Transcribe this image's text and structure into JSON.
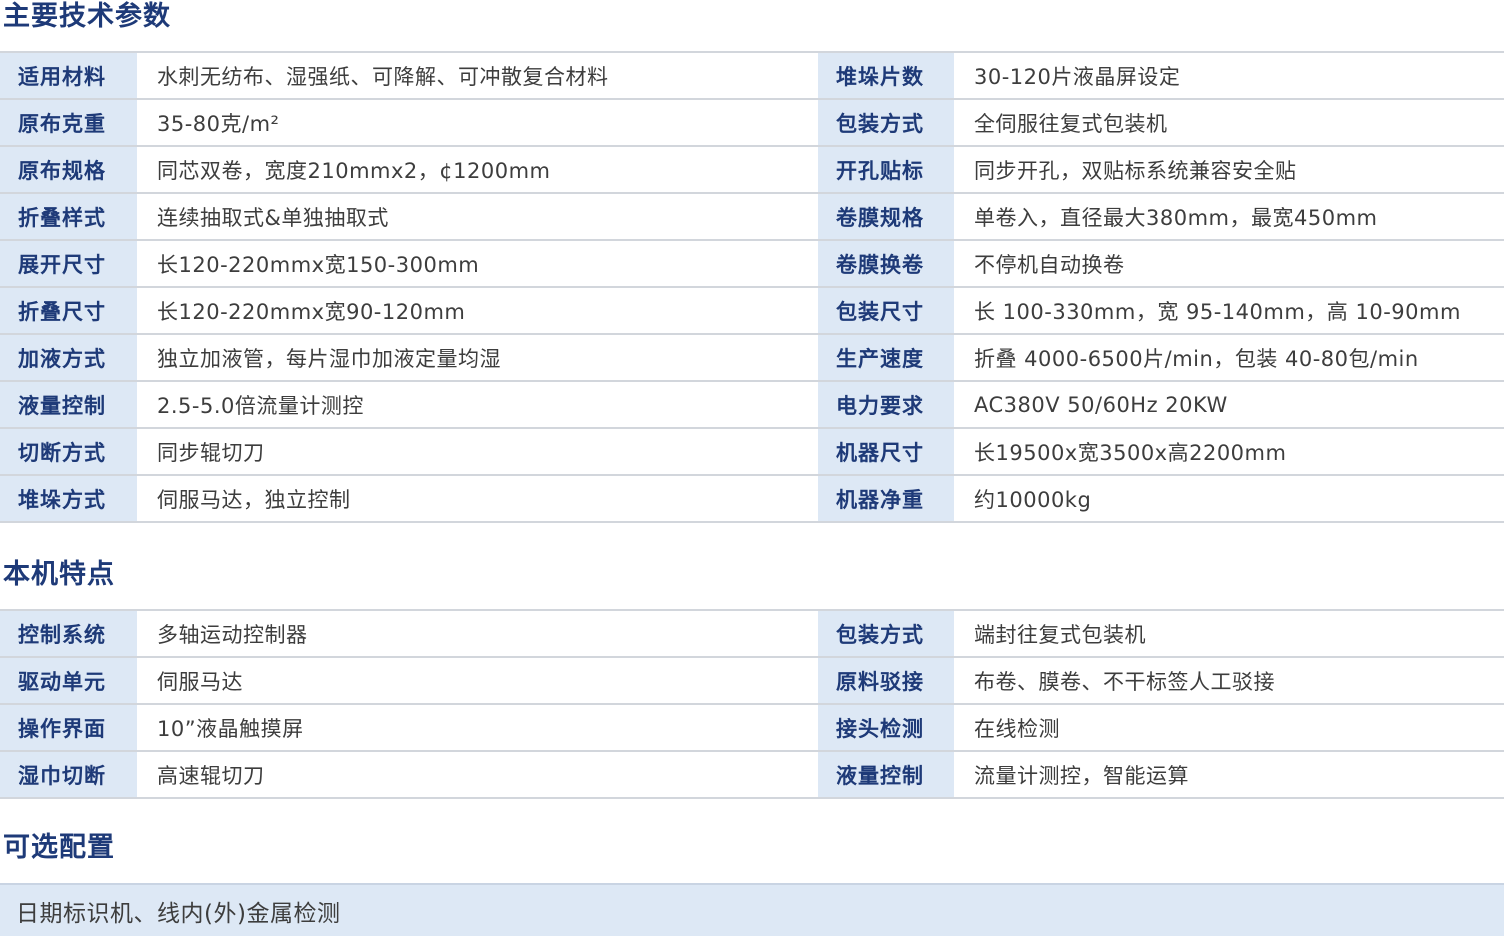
{
  "sections": {
    "main_specs": {
      "title": "主要技术参数",
      "rows": [
        {
          "left_label": "适用材料",
          "left_value": "水刺无纺布、湿强纸、可降解、可冲散复合材料",
          "right_label": "堆垛片数",
          "right_value": "30-120片液晶屏设定"
        },
        {
          "left_label": "原布克重",
          "left_value": "35-80克/m²",
          "right_label": "包装方式",
          "right_value": "全伺服往复式包装机"
        },
        {
          "left_label": "原布规格",
          "left_value": "同芯双卷，宽度210mmx2，¢1200mm",
          "right_label": "开孔贴标",
          "right_value": "同步开孔，双贴标系统兼容安全贴"
        },
        {
          "left_label": "折叠样式",
          "left_value": "连续抽取式&单独抽取式",
          "right_label": "卷膜规格",
          "right_value": "单卷入，直径最大380mm，最宽450mm"
        },
        {
          "left_label": "展开尺寸",
          "left_value": "长120-220mmx宽150-300mm",
          "right_label": "卷膜换卷",
          "right_value": "不停机自动换卷"
        },
        {
          "left_label": "折叠尺寸",
          "left_value": "长120-220mmx宽90-120mm",
          "right_label": "包装尺寸",
          "right_value": "长 100-330mm，宽 95-140mm，高 10-90mm"
        },
        {
          "left_label": "加液方式",
          "left_value": "独立加液管，每片湿巾加液定量均湿",
          "right_label": "生产速度",
          "right_value": "折叠 4000-6500片/min，包装 40-80包/min"
        },
        {
          "left_label": "液量控制",
          "left_value": "2.5-5.0倍流量计测控",
          "right_label": "电力要求",
          "right_value": "AC380V  50/60Hz  20KW"
        },
        {
          "left_label": "切断方式",
          "left_value": "同步辊切刀",
          "right_label": "机器尺寸",
          "right_value": "长19500x宽3500x高2200mm"
        },
        {
          "left_label": "堆垛方式",
          "left_value": "伺服马达，独立控制",
          "right_label": "机器净重",
          "right_value": "约10000kg"
        }
      ]
    },
    "features": {
      "title": "本机特点",
      "rows": [
        {
          "left_label": "控制系统",
          "left_value": "多轴运动控制器",
          "right_label": "包装方式",
          "right_value": "端封往复式包装机"
        },
        {
          "left_label": "驱动单元",
          "left_value": "伺服马达",
          "right_label": "原料驳接",
          "right_value": "布卷、膜卷、不干标签人工驳接"
        },
        {
          "left_label": "操作界面",
          "left_value": "10”液晶触摸屏",
          "right_label": "接头检测",
          "right_value": "在线检测"
        },
        {
          "left_label": "湿巾切断",
          "left_value": "高速辊切刀",
          "right_label": "液量控制",
          "right_value": "流量计测控，智能运算"
        }
      ]
    },
    "options": {
      "title": "可选配置",
      "text": "日期标识机、线内(外)金属检测"
    }
  },
  "colors": {
    "title": "#1e3a78",
    "label_bg": "#dde8f5",
    "border": "#d2d6dc",
    "text": "#3d3d3d"
  }
}
